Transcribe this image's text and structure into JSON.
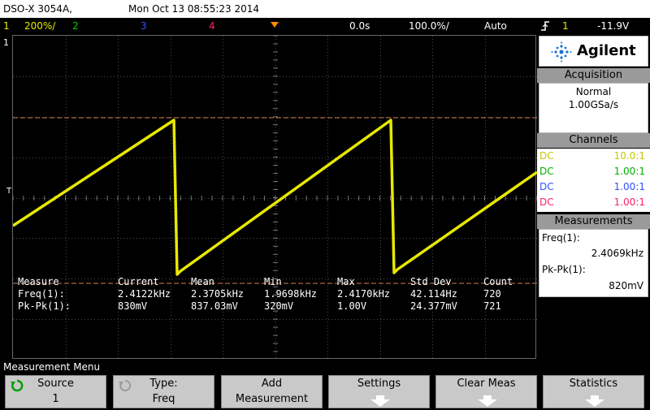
{
  "header": {
    "model": "DSO-X 3054A,",
    "datetime": "Mon Oct 13 08:55:23 2014"
  },
  "status": {
    "ch1_num": "1",
    "ch1_scale": "200%/",
    "ch2_num": "2",
    "ch3_num": "3",
    "ch4_num": "4",
    "time_delay": "0.0s",
    "time_scale": "100.0%/",
    "trigger_mode": "Auto",
    "trigger_slope_icon": "rising-edge-icon",
    "trigger_source": "1",
    "trigger_level": "-11.9V"
  },
  "graticule": {
    "ch1_marker": "1",
    "trigger_marker": "T"
  },
  "measurement_table": {
    "headers": [
      "Measure",
      "Current",
      "Mean",
      "Min",
      "Max",
      "Std Dev",
      "Count"
    ],
    "rows": [
      [
        "Freq(1):",
        "2.4122kHz",
        "2.3705kHz",
        "1.9698kHz",
        "2.4170kHz",
        "42.114Hz",
        "720"
      ],
      [
        "Pk-Pk(1):",
        "830mV",
        "837.03mV",
        "320mV",
        "1.00V",
        "24.377mV",
        "721"
      ]
    ]
  },
  "panel": {
    "brand": "Agilent",
    "acquisition": {
      "title": "Acquisition",
      "mode": "Normal",
      "rate": "1.00GSa/s"
    },
    "channels": {
      "title": "Channels",
      "items": [
        {
          "coupling": "DC",
          "ratio": "10.0:1",
          "color": "#e8e800"
        },
        {
          "coupling": "DC",
          "ratio": "1.00:1",
          "color": "#00d000"
        },
        {
          "coupling": "DC",
          "ratio": "1.00:1",
          "color": "#3050ff"
        },
        {
          "coupling": "DC",
          "ratio": "1.00:1",
          "color": "#ff2060"
        }
      ]
    },
    "measurements": {
      "title": "Measurements",
      "freq_label": "Freq(1):",
      "freq_value": "2.4069kHz",
      "pkpk_label": "Pk-Pk(1):",
      "pkpk_value": "820mV"
    }
  },
  "menu": {
    "title": "Measurement Menu",
    "softkeys": [
      {
        "line1": "Source",
        "line2": "1",
        "icon": "rotate-knob-icon"
      },
      {
        "line1": "Type:",
        "line2": "Freq",
        "icon": "rotate-knob-icon"
      },
      {
        "line1": "Add",
        "line2": "Measurement"
      },
      {
        "line1": "Settings",
        "icon": "down-arrow-icon"
      },
      {
        "line1": "Clear Meas",
        "icon": "down-arrow-icon"
      },
      {
        "line1": "Statistics",
        "icon": "down-arrow-icon"
      }
    ]
  },
  "colors": {
    "ch1": "#e8e800",
    "ch2": "#00d000",
    "ch3": "#3050ff",
    "ch4": "#ff2060",
    "trigger_marker": "#ff8c00",
    "cursor_line": "#d08050"
  }
}
